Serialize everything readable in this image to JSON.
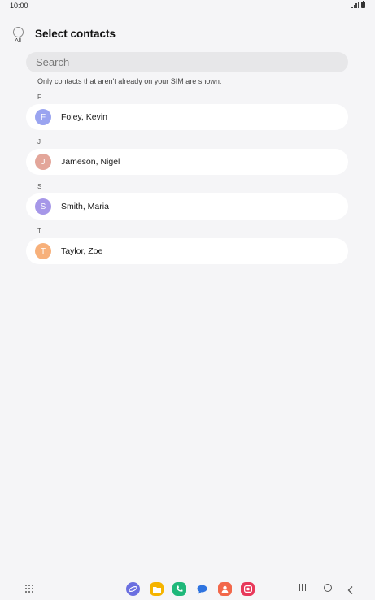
{
  "status_bar": {
    "time": "10:00"
  },
  "header": {
    "all_label": "All",
    "title": "Select contacts"
  },
  "search": {
    "placeholder": "Search"
  },
  "notice": "Only contacts that aren't already on your SIM are shown.",
  "sections": [
    {
      "letter": "F",
      "contact": {
        "initial": "F",
        "name": "Foley, Kevin",
        "avatar_color": "#9aa4f0"
      }
    },
    {
      "letter": "J",
      "contact": {
        "initial": "J",
        "name": "Jameson, Nigel",
        "avatar_color": "#e3a69a"
      }
    },
    {
      "letter": "S",
      "contact": {
        "initial": "S",
        "name": "Smith, Maria",
        "avatar_color": "#a697e8"
      }
    },
    {
      "letter": "T",
      "contact": {
        "initial": "T",
        "name": "Taylor, Zoe",
        "avatar_color": "#f7b07a"
      }
    }
  ],
  "nav_bar": {
    "dock_apps": [
      {
        "icon": "internet-icon",
        "color": "#6b6fe0"
      },
      {
        "icon": "my-files-icon",
        "color": "#f5b400"
      },
      {
        "icon": "phone-icon",
        "color": "#1fb87a"
      },
      {
        "icon": "messages-icon",
        "color": "#2f74e0"
      },
      {
        "icon": "contacts-icon",
        "color": "#f2674a"
      },
      {
        "icon": "screen-recorder-icon",
        "color": "#e8385a"
      }
    ]
  }
}
